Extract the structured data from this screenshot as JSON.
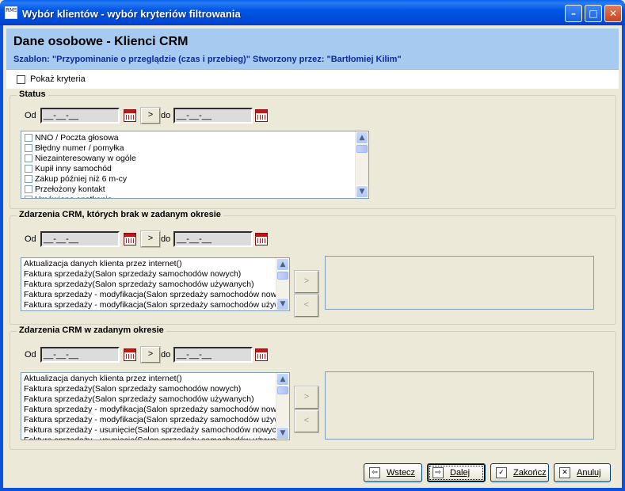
{
  "window": {
    "app_icon_text": "RMS",
    "title": "Wybór klientów - wybór kryteriów filtrowania",
    "minimize_glyph": "–",
    "maximize_glyph": "□",
    "close_glyph": "✕"
  },
  "header": {
    "title": "Dane osobowe - Klienci CRM",
    "subtitle": "Szablon: \"Przypominanie o przeglądzie (czas i przebieg)\" Stworzony przez: \"Bartłomiej Kilim\""
  },
  "show_criteria": {
    "label": "Pokaż kryteria",
    "checked": false
  },
  "date_range": {
    "from_label": "Od",
    "to_label": "do",
    "date_placeholder": "__-__-__",
    "next_glyph": ">"
  },
  "status_group": {
    "title": "Status",
    "items": [
      "NNO / Poczta głosowa",
      "Błędny numer / pomyłka",
      "Niezainteresowany w ogóle",
      "Kupił inny samochód",
      "Zakup później niż 6 m-cy",
      "Przełożony kontakt",
      "Umówione spotkanie"
    ]
  },
  "events_missing_group": {
    "title": "Zdarzenia CRM, których brak w zadanym okresie",
    "items": [
      "Aktualizacja danych klienta przez internet()",
      "Faktura sprzedaży(Salon sprzedaży samochodów nowych)",
      "Faktura sprzedaży(Salon sprzedaży samochodów używanych)",
      "Faktura sprzedaży - modyfikacja(Salon sprzedaży samochodów nowych)",
      "Faktura sprzedaży - modyfikacja(Salon sprzedaży samochodów używanych)"
    ],
    "add_glyph": ">",
    "remove_glyph": "<"
  },
  "events_in_period_group": {
    "title": "Zdarzenia CRM w zadanym okresie",
    "items": [
      "Aktualizacja danych klienta przez internet()",
      "Faktura sprzedaży(Salon sprzedaży samochodów nowych)",
      "Faktura sprzedaży(Salon sprzedaży samochodów używanych)",
      "Faktura sprzedaży - modyfikacja(Salon sprzedaży samochodów nowych)",
      "Faktura sprzedaży - modyfikacja(Salon sprzedaży samochodów używanych)",
      "Faktura sprzedaży - usunięcie(Salon sprzedaży samochodów nowych)",
      "Faktura sprzedaży - usunięcie(Salon sprzedaży samochodów używanych)"
    ],
    "add_glyph": ">",
    "remove_glyph": "<"
  },
  "scroll": {
    "up_glyph": "▲",
    "down_glyph": "▼"
  },
  "footer": {
    "back": {
      "label": "Wstecz",
      "icon_glyph": "⇦"
    },
    "next": {
      "label": "Dalej",
      "icon_glyph": "⇨"
    },
    "finish": {
      "label": "Zakończ",
      "icon_glyph": "✓"
    },
    "cancel": {
      "label": "Anuluj",
      "icon_glyph": "✕"
    }
  }
}
